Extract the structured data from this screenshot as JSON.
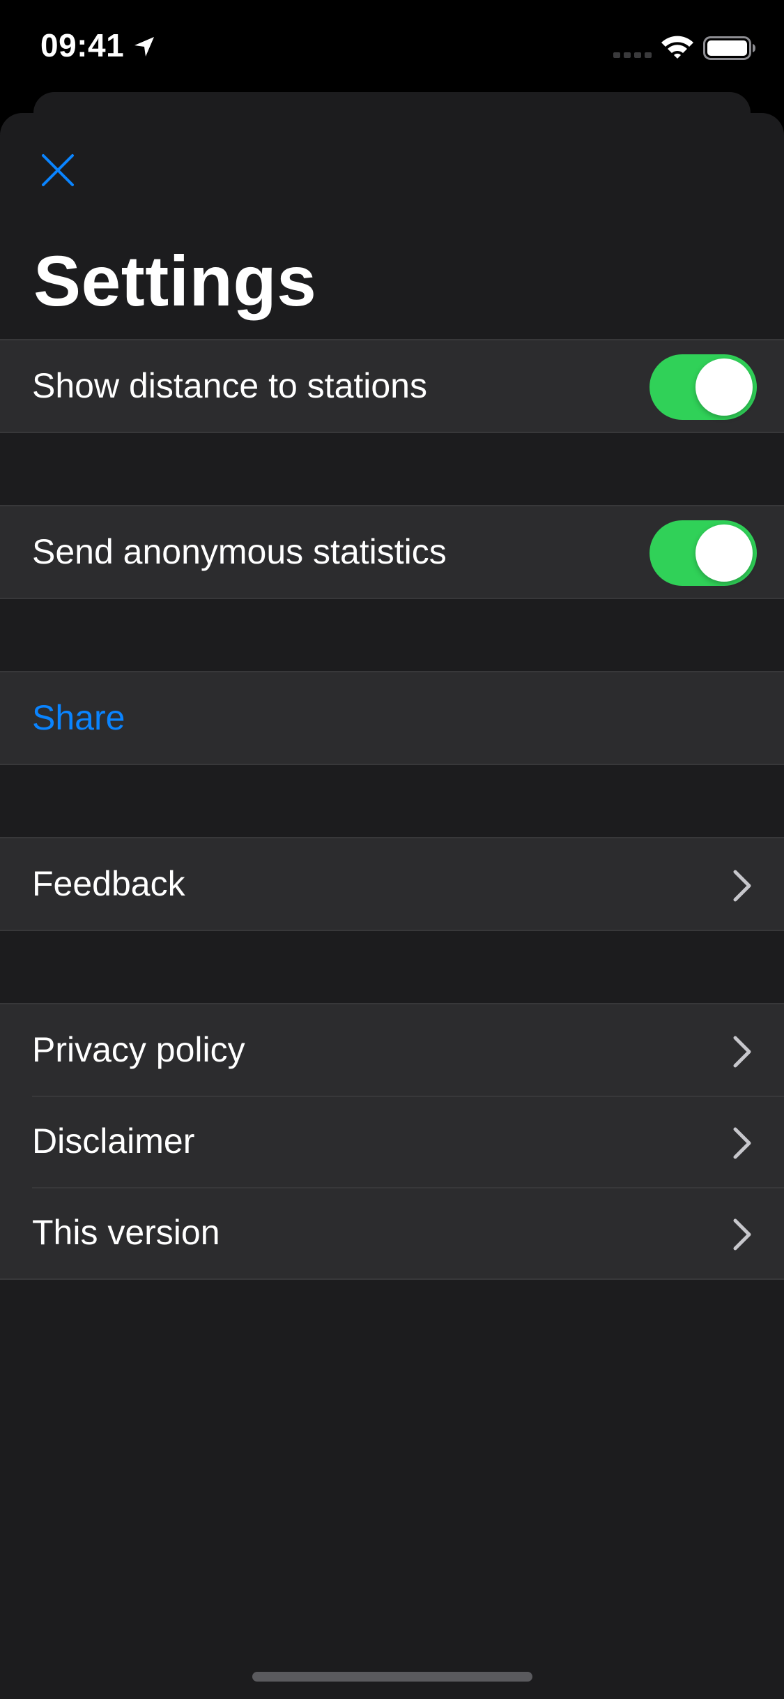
{
  "status_bar": {
    "time": "09:41",
    "icons": [
      "location-arrow-icon",
      "cellular-signal-icon",
      "wifi-icon",
      "battery-icon"
    ]
  },
  "sheet": {
    "close_icon": "close-icon",
    "title": "Settings"
  },
  "settings": {
    "show_distance": {
      "label": "Show distance to stations",
      "enabled": true
    },
    "send_statistics": {
      "label": "Send anonymous statistics",
      "enabled": true
    },
    "share": {
      "label": "Share"
    },
    "feedback": {
      "label": "Feedback"
    },
    "privacy_policy": {
      "label": "Privacy policy"
    },
    "disclaimer": {
      "label": "Disclaimer"
    },
    "this_version": {
      "label": "This version"
    }
  },
  "colors": {
    "background": "#000000",
    "sheet": "#1c1c1e",
    "row": "#2c2c2e",
    "separator": "#38383a",
    "accent": "#0a84ff",
    "toggle_on": "#30d158",
    "home_indicator": "#5a5a5e"
  }
}
